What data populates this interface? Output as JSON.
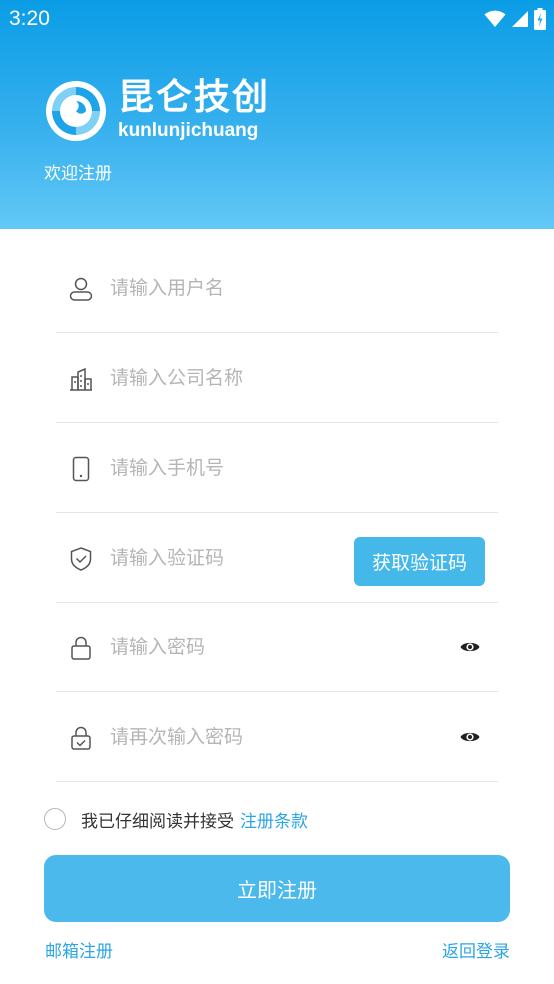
{
  "status": {
    "time": "3:20"
  },
  "brand": {
    "name_cn": "昆仑技创",
    "name_en": "kunlunjichuang",
    "welcome": "欢迎注册"
  },
  "form": {
    "username_placeholder": "请输入用户名",
    "company_placeholder": "请输入公司名称",
    "phone_placeholder": "请输入手机号",
    "code_placeholder": "请输入验证码",
    "get_code_label": "获取验证码",
    "password_placeholder": "请输入密码",
    "password_confirm_placeholder": "请再次输入密码"
  },
  "agreement": {
    "text": "我已仔细阅读并接受",
    "link": "注册条款"
  },
  "actions": {
    "register": "立即注册",
    "email_register": "邮箱注册",
    "back_login": "返回登录"
  },
  "colors": {
    "header_top": "#0a9de6",
    "header_bottom": "#63c8f6",
    "accent": "#45b8ea",
    "link": "#2ba6e3"
  }
}
